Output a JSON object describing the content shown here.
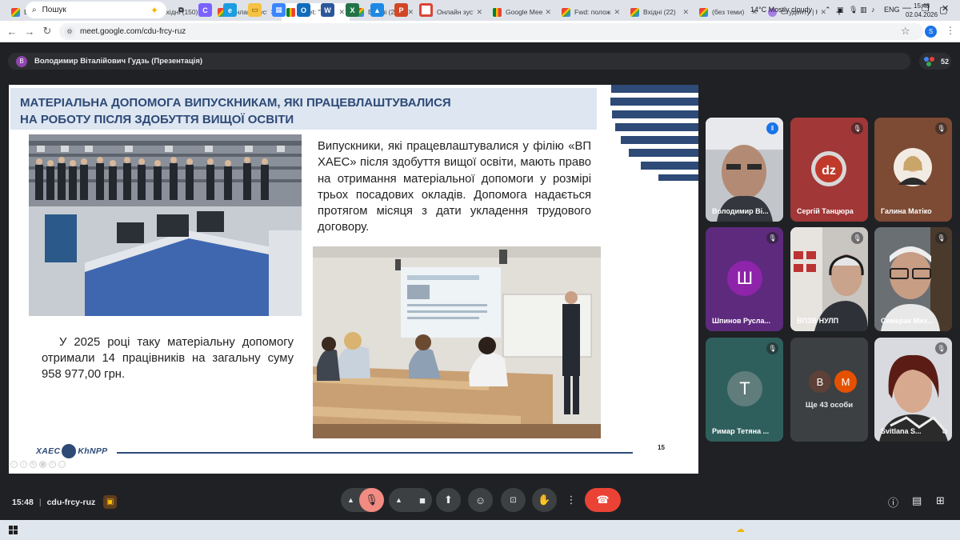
{
  "browser": {
    "tabs": [
      {
        "label": "Вхідні (150)",
        "icon": "gmail-icon",
        "active": false
      },
      {
        "label": "Вхідні (2 976)",
        "icon": "gmail-icon",
        "active": false
      },
      {
        "label": "Вхідні (150)",
        "icon": "gmail-icon",
        "active": false
      },
      {
        "label": "Онлайн зуст",
        "icon": "gmail-icon",
        "active": false
      },
      {
        "label": "Meet: \"c",
        "icon": "meet-icon",
        "active": true
      },
      {
        "label": "Вхідні (2 976",
        "icon": "gmail-icon",
        "active": false
      },
      {
        "label": "Онлайн зуст",
        "icon": "gmail-icon",
        "active": false
      },
      {
        "label": "Google Mee",
        "icon": "meet-icon",
        "active": false
      },
      {
        "label": "Fwd: полож",
        "icon": "gmail-icon",
        "active": false
      },
      {
        "label": "Вхідні (22)",
        "icon": "gmail-icon",
        "active": false
      },
      {
        "label": "(без теми)",
        "icon": "gmail-icon",
        "active": false
      },
      {
        "label": "Студенту | Н",
        "icon": "edu-icon",
        "active": false
      }
    ],
    "url": "meet.google.com/cdu-frcy-ruz",
    "profile_initial": "S"
  },
  "meet": {
    "presenter": {
      "initial": "В",
      "label": "Володимир Віталійович Гудзь (Презентація)"
    },
    "participant_count": "52",
    "meeting_time": "15:48",
    "meeting_code": "cdu-frcy-ruz",
    "participants": [
      {
        "name": "Володимир Ві...",
        "mic": "active"
      },
      {
        "name": "Сергій Танцюра",
        "mic": "muted"
      },
      {
        "name": "Галина Матіко",
        "mic": "muted"
      },
      {
        "name": "Шпинов Руслa...",
        "mic": "muted",
        "initial": "Ш"
      },
      {
        "name": "ВПЗВ НУЛП",
        "mic": "muted"
      },
      {
        "name": "Семерак Мих...",
        "mic": "muted"
      },
      {
        "name": "Римар Тетяна ...",
        "mic": "muted",
        "initial": "Т"
      },
      {
        "name": "Ще 43 особи",
        "avatars": [
          "В",
          "М"
        ]
      },
      {
        "name": "Svitlana S...",
        "mic": "muted"
      }
    ]
  },
  "slide": {
    "title_line1": "МАТЕРІАЛЬНА ДОПОМОГА ВИПУСКНИКАМ, ЯКІ ПРАЦЕВЛАШТУВАЛИСЯ",
    "title_line2": "НА РОБОТУ ПІСЛЯ ЗДОБУТТЯ ВИЩОЇ ОСВІТИ",
    "paragraph1": "Випускники, які працевлаштувалися у філію «ВП ХАЕС» після здобуття вищої освіти, мають право на отримання матеріальної допомоги у розмірі трьох посадових окладів. Допомога надається протягом місяця з дати укладення трудового договору.",
    "paragraph2": "У 2025 році таку матеріальну допомогу отримали 14 працівників на загальну суму 958 977,00 грн.",
    "logo_left": "ХАЕС",
    "logo_right": "KhNPP",
    "page_number": "15",
    "brand_color": "#2e4a77"
  },
  "taskbar": {
    "search_placeholder": "Пошук",
    "weather": "14°C  Mostly cloudy",
    "language": "ENG",
    "time": "15:48",
    "date": "02.04.2026"
  }
}
